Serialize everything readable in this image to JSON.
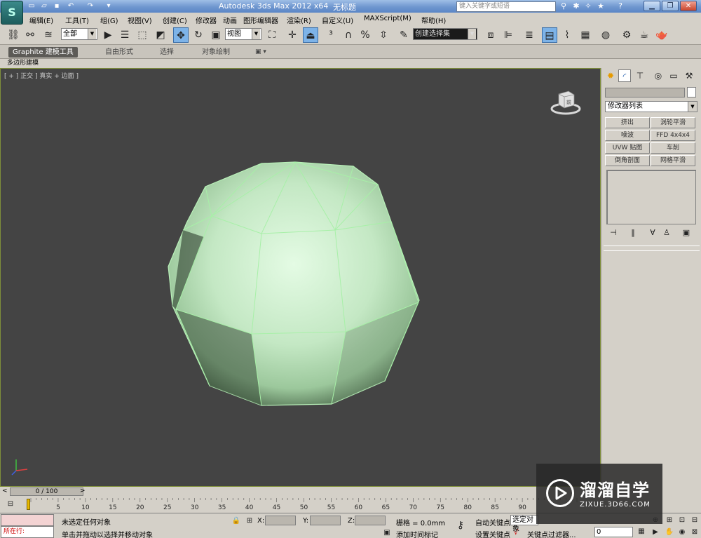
{
  "app": {
    "title": "Autodesk 3ds Max  2012 x64",
    "document": "无标题",
    "search_placeholder": "键入关键字或短语"
  },
  "menu": [
    "编辑(E)",
    "工具(T)",
    "组(G)",
    "视图(V)",
    "创建(C)",
    "修改器",
    "动画",
    "图形编辑器",
    "渲染(R)",
    "自定义(U)",
    "MAXScript(M)",
    "帮助(H)"
  ],
  "toolbar": {
    "selection_filter": "全部",
    "ref_coord": "视图",
    "named_selection": "创建选择集"
  },
  "ribbon": {
    "tabs": [
      "Graphite 建模工具",
      "自由形式",
      "选择",
      "对象绘制"
    ],
    "active_tab": "Graphite 建模工具",
    "subtab": "多边形建模"
  },
  "viewport": {
    "label": "[ + ] 正交 ] 真实 + 边面 ]",
    "viewcube_face": "前"
  },
  "command_panel": {
    "modifier_list": "修改器列表",
    "modifier_buttons": [
      "挤出",
      "涡轮平滑",
      "噪波",
      "FFD 4x4x4",
      "UVW 贴图",
      "车削",
      "倒角剖面",
      "网格平滑"
    ]
  },
  "timeline": {
    "frame_display": "0 / 100",
    "ticks": [
      "5",
      "10",
      "15",
      "20",
      "25",
      "30",
      "35",
      "40",
      "45",
      "50",
      "55",
      "60",
      "65",
      "70",
      "75",
      "80",
      "85",
      "90"
    ]
  },
  "status": {
    "script_label": "所在行:",
    "selection_status": "未选定任何对象",
    "prompt": "单击并拖动以选择并移动对象",
    "x_label": "X:",
    "y_label": "Y:",
    "z_label": "Z:",
    "grid": "栅格 = 0.0mm",
    "add_time_tag": "添加时间标记",
    "auto_key": "自动关键点",
    "selected": "选定对象",
    "set_key": "设置关键点",
    "key_filters": "关键点过滤器...",
    "current_frame": "0"
  },
  "watermark": {
    "title": "溜溜自学",
    "subtitle": "ZIXUE.3D66.COM"
  },
  "colors": {
    "viewport_bg": "#444444",
    "mesh_fill": "#c9edc9",
    "mesh_edge": "#a8f0a8",
    "selected_tool": "#7db3e8"
  }
}
